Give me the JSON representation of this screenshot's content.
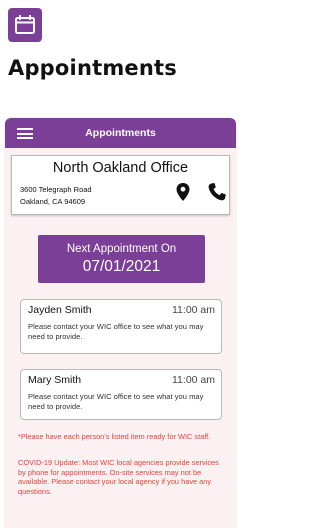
{
  "page": {
    "heading": "Appointments"
  },
  "icons": {
    "top": "calendar-icon",
    "menu": "hamburger-menu-icon",
    "location": "map-pin-icon",
    "call": "phone-icon"
  },
  "colors": {
    "brand": "#7c3f97",
    "notice": "#e0473d",
    "background": "#fbf0f2"
  },
  "appbar": {
    "title": "Appointments"
  },
  "office": {
    "name": "North Oakland Office",
    "address_line1": "3600 Telegraph Road",
    "address_line2": "Oakland, CA 94609"
  },
  "next_appointment": {
    "label": "Next Appointment On",
    "date": "07/01/2021"
  },
  "appointments": [
    {
      "name": "Jayden Smith",
      "time": "11:00 am",
      "note": "Please contact your WIC office to see what you may need to provide."
    },
    {
      "name": "Mary Smith",
      "time": "11:00 am",
      "note": "Please contact your WIC office to see what you may need to provide."
    }
  ],
  "notices": [
    "*Please have each person's listed item ready for WIC staff.",
    "COVID-19 Update: Most WIC local agencies provide services by phone for appointments. On-site services may not be available. Please contact your local agency if you have any questions."
  ]
}
